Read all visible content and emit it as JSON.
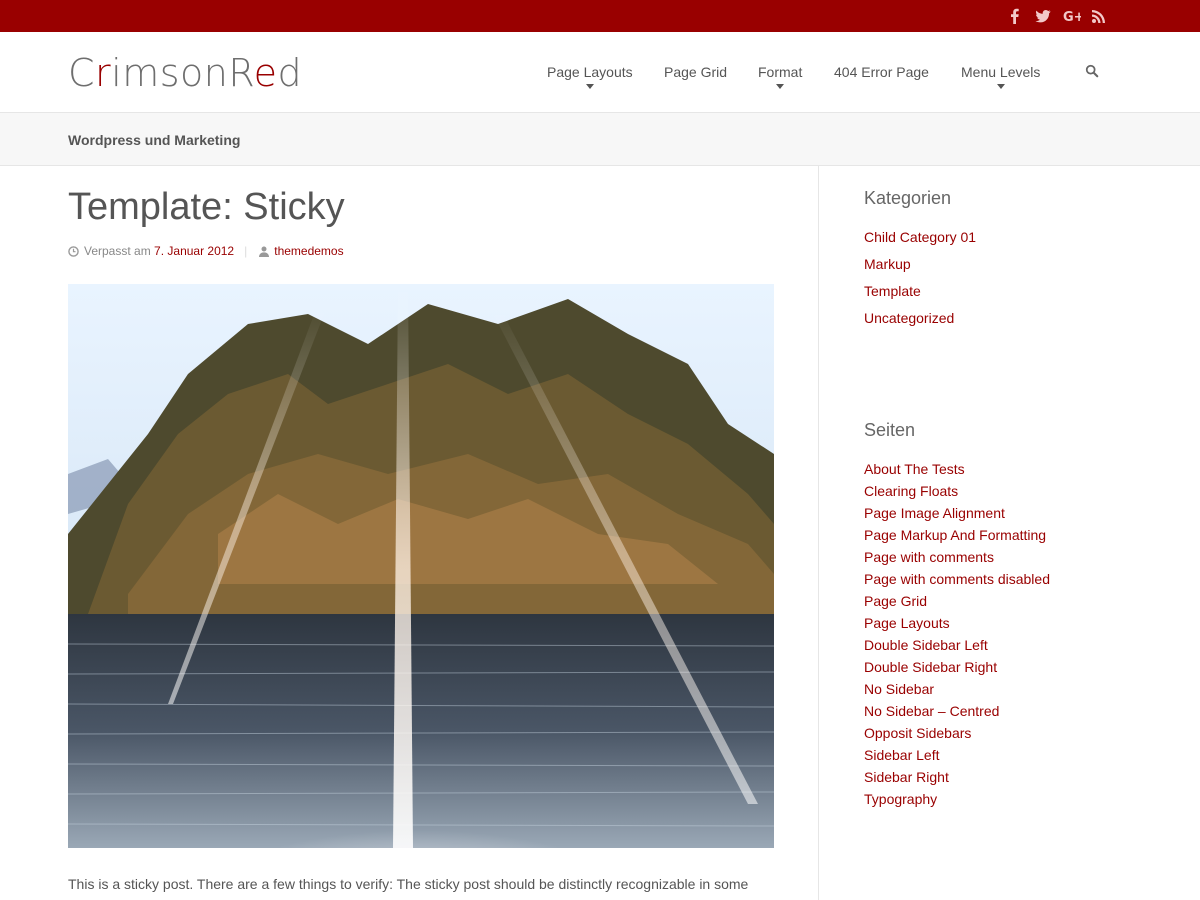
{
  "topbar": {
    "bg_color": "#990000",
    "social_icons": [
      "facebook-icon",
      "twitter-icon",
      "google-plus-icon",
      "rss-icon"
    ]
  },
  "header": {
    "logo_parts": [
      "C",
      "r",
      "imsonR",
      "e",
      "d"
    ],
    "nav": [
      {
        "label": "Page Layouts",
        "has_dropdown": true
      },
      {
        "label": "Page Grid",
        "has_dropdown": false
      },
      {
        "label": "Format",
        "has_dropdown": true
      },
      {
        "label": "404 Error Page",
        "has_dropdown": false
      },
      {
        "label": "Menu Levels",
        "has_dropdown": true
      }
    ],
    "search_icon": "search-icon"
  },
  "subheader": {
    "tagline": "Wordpress und Marketing"
  },
  "post": {
    "title": "Template: Sticky",
    "meta_prefix": "Verpasst am",
    "date": "7. Januar 2012",
    "author": "themedemos",
    "excerpt": "This is a sticky post. There are a few things to verify: The sticky post should be distinctly recognizable in some"
  },
  "sidebar": {
    "categories_title": "Kategorien",
    "categories": [
      "Child Category 01",
      "Markup",
      "Template",
      "Uncategorized"
    ],
    "pages_title": "Seiten",
    "pages": [
      "About The Tests",
      "Clearing Floats",
      "Page Image Alignment",
      "Page Markup And Formatting",
      "Page with comments",
      "Page with comments disabled",
      "Page Grid",
      "Page Layouts",
      "Double Sidebar Left",
      "Double Sidebar Right",
      "No Sidebar",
      "No Sidebar – Centred",
      "Opposit Sidebars",
      "Sidebar Left",
      "Sidebar Right",
      "Typography"
    ]
  },
  "accent_color": "#990000"
}
